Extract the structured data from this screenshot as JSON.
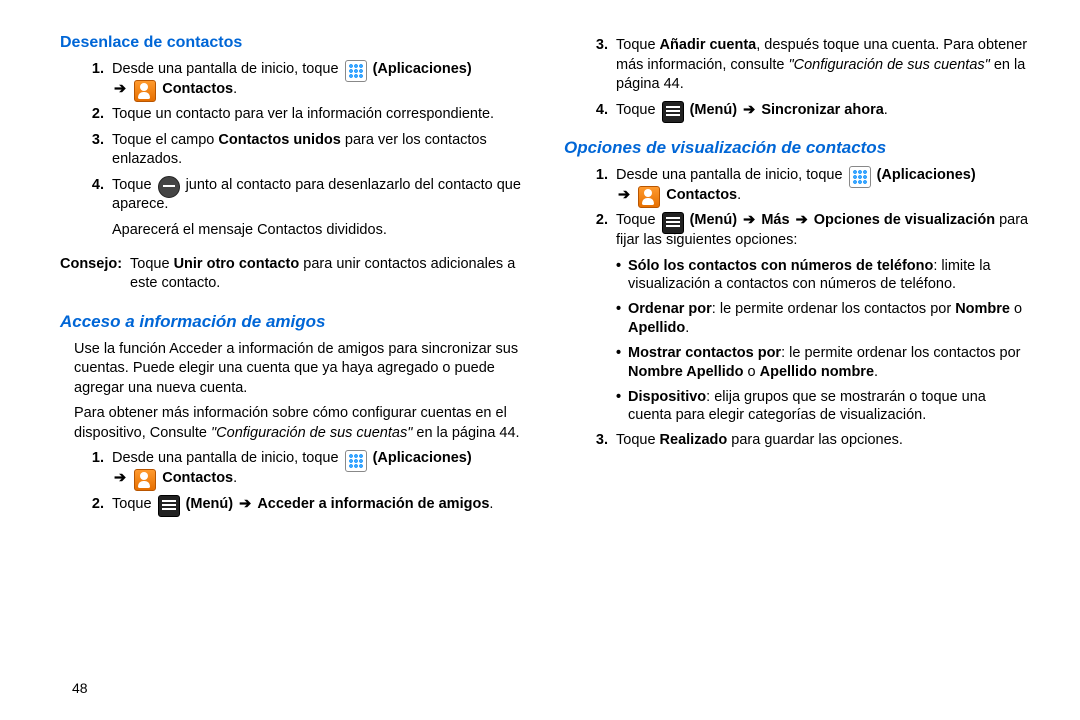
{
  "page_number": "48",
  "left": {
    "h1": "Desenlace de contactos",
    "steps_a": {
      "s1_pre": "Desde una pantalla de inicio, toque ",
      "s1_apps": "(Aplicaciones)",
      "s1_contacts": "Contactos",
      "s2": "Toque un contacto para ver la información correspondiente.",
      "s3_pre": "Toque el campo ",
      "s3_bold": "Contactos unidos",
      "s3_post": " para ver los contactos enlazados.",
      "s4_pre": "Toque ",
      "s4_post": " junto al contacto para desenlazarlo del contacto que aparece."
    },
    "note_a": "Aparecerá el mensaje Contactos divididos.",
    "tip_label": "Consejo:",
    "tip_pre": "Toque ",
    "tip_bold": "Unir otro contacto",
    "tip_post": " para unir contactos adicionales a este contacto.",
    "h2": "Acceso a información de amigos",
    "para1": "Use la función Acceder a información de amigos para sincronizar sus cuentas. Puede elegir una cuenta que ya haya agregado o puede agregar una nueva cuenta.",
    "para2_pre": "Para obtener más información sobre cómo configurar cuentas en el dispositivo, Consulte ",
    "para2_italic": "\"Configuración de sus cuentas\"",
    "para2_post": " en la página 44.",
    "steps_b": {
      "s1_pre": "Desde una pantalla de inicio, toque ",
      "s1_apps": "(Aplicaciones)",
      "s1_contacts": "Contactos",
      "s2_pre": "Toque ",
      "s2_menu": "(Menú)",
      "s2_arrow_label": "Acceder a información de amigos"
    }
  },
  "right": {
    "cont": {
      "s3_pre": "Toque ",
      "s3_bold": "Añadir cuenta",
      "s3_mid": ", después toque una cuenta. Para obtener más información, consulte ",
      "s3_italic": "\"Configuración de sus cuentas\"",
      "s3_post": " en la página 44.",
      "s4_pre": "Toque ",
      "s4_menu": "(Menú)",
      "s4_label": "Sincronizar ahora"
    },
    "h3": "Opciones de visualización de contactos",
    "steps_c": {
      "s1_pre": "Desde una pantalla de inicio, toque ",
      "s1_apps": "(Aplicaciones)",
      "s1_contacts": "Contactos",
      "s2_pre": "Toque ",
      "s2_menu": "(Menú)",
      "s2_more": "Más",
      "s2_op": "Opciones de visualización",
      "s2_post": " para fijar las siguientes opciones:"
    },
    "bullets": {
      "b1_bold": "Sólo los contactos con números de teléfono",
      "b1_post": ": limite la visualización a contactos con números de teléfono.",
      "b2_bold": "Ordenar por",
      "b2_mid": ": le permite ordenar los contactos por ",
      "b2_opt1": "Nombre",
      "b2_or": " o ",
      "b2_opt2": "Apellido",
      "b3_bold": "Mostrar contactos por",
      "b3_mid": ": le permite ordenar los contactos por ",
      "b3_opt1": "Nombre Apellido",
      "b3_or": " o ",
      "b3_opt2": "Apellido nombre",
      "b4_bold": "Dispositivo",
      "b4_post": ": elija grupos que se mostrarán o toque una cuenta para elegir categorías de visualización."
    },
    "s3_final_pre": "Toque ",
    "s3_final_bold": "Realizado",
    "s3_final_post": " para guardar las opciones."
  },
  "arrow": "➔",
  "period": "."
}
